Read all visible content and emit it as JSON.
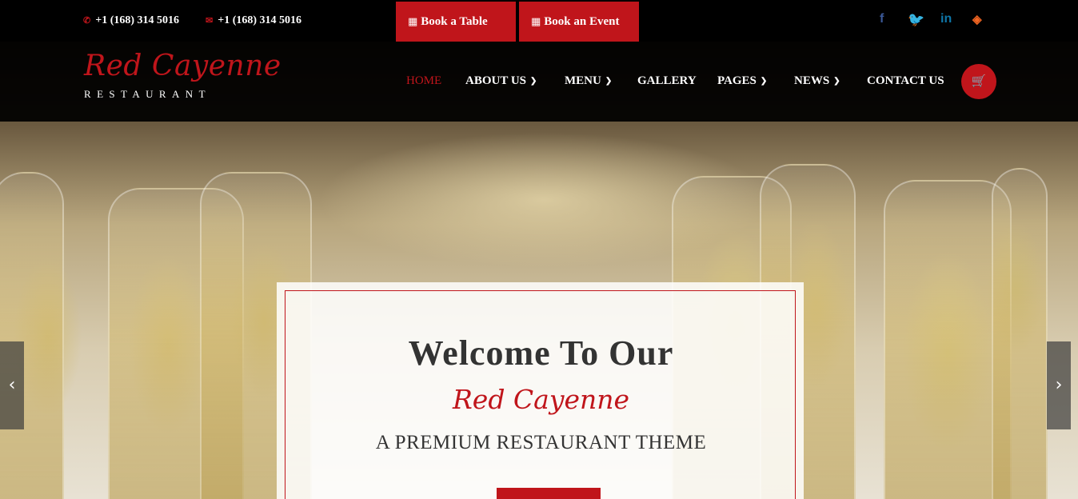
{
  "topbar": {
    "phone1": "+1 (168) 314 5016",
    "phone2": "+1 (168) 314 5016",
    "book_table": "Book a Table",
    "book_event": "Book an Event"
  },
  "social": {
    "facebook": "f",
    "twitter": "t",
    "linkedin": "in",
    "rss": "rss"
  },
  "logo": {
    "script": "Red Cayenne",
    "sub": "RESTAURANT"
  },
  "nav": {
    "home": "HOME",
    "about": "ABOUT US",
    "menu": "MENU",
    "gallery": "GALLERY",
    "pages": "PAGES",
    "news": "NEWS",
    "contact": "CONTACT US"
  },
  "hero": {
    "title": "Welcome To Our",
    "script": "Red Cayenne",
    "subtitle": "A PREMIUM RESTAURANT THEME"
  },
  "colors": {
    "accent": "#c0151b",
    "facebook": "#3b5998",
    "twitter": "#1da1f2",
    "linkedin": "#0e76a8",
    "rss": "#f26522"
  },
  "icons": {
    "phone": "phone-icon",
    "email": "envelope-icon",
    "table": "table-icon",
    "calendar": "calendar-icon",
    "cart": "cart-icon",
    "chevron": "chevron-down-icon",
    "prev": "chevron-left-icon",
    "next": "chevron-right-icon"
  }
}
